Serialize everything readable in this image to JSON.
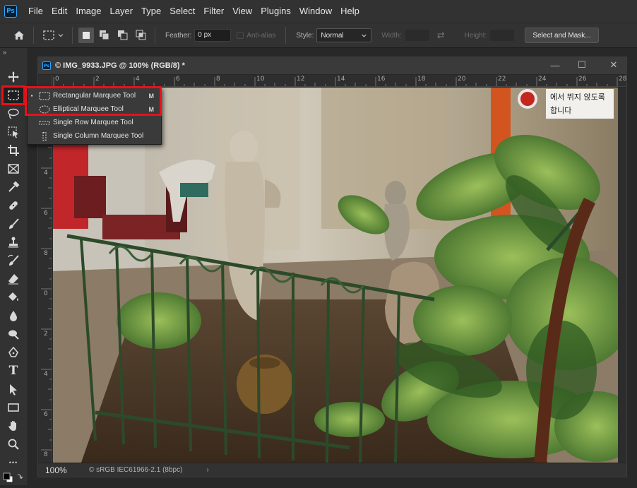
{
  "app": {
    "logo": "Ps"
  },
  "menu": [
    "File",
    "Edit",
    "Image",
    "Layer",
    "Type",
    "Select",
    "Filter",
    "View",
    "Plugins",
    "Window",
    "Help"
  ],
  "options": {
    "feather_label": "Feather:",
    "feather_value": "0 px",
    "antialias_label": "Anti-alias",
    "style_label": "Style:",
    "style_value": "Normal",
    "width_label": "Width:",
    "height_label": "Height:",
    "select_mask_label": "Select and Mask..."
  },
  "document": {
    "title": "© IMG_9933.JPG @ 100% (RGB/8) *",
    "zoom": "100%",
    "profile": "© sRGB IEC61966-2.1 (8bpc)",
    "chevron": "›",
    "ruler_top": [
      "0",
      "2",
      "4",
      "6",
      "8",
      "10",
      "12",
      "14",
      "16",
      "18",
      "20",
      "22",
      "24",
      "26",
      "28"
    ],
    "ruler_left": [
      "0",
      "2",
      "4",
      "6",
      "8",
      "0",
      "2",
      "4",
      "6",
      "8",
      "0"
    ],
    "sign_line1": "에서 뛰지 않도록",
    "sign_line2": "합니다"
  },
  "flyout": {
    "items": [
      {
        "label": "Rectangular Marquee Tool",
        "key": "M",
        "selected": "▪"
      },
      {
        "label": "Elliptical Marquee Tool",
        "key": "M",
        "selected": ""
      },
      {
        "label": "Single Row Marquee Tool",
        "key": "",
        "selected": ""
      },
      {
        "label": "Single Column Marquee Tool",
        "key": "",
        "selected": ""
      }
    ]
  },
  "toolbar": {
    "collapse": "»",
    "tools": [
      "move-icon",
      "rectangular-marquee-icon",
      "lasso-icon",
      "object-selection-icon",
      "crop-icon",
      "frame-icon",
      "eyedropper-icon",
      "spot-healing-icon",
      "brush-icon",
      "clone-stamp-icon",
      "history-brush-icon",
      "eraser-icon",
      "paint-bucket-icon",
      "blur-icon",
      "dodge-icon",
      "pen-icon",
      "type-icon",
      "path-selection-icon",
      "rectangle-icon",
      "hand-icon",
      "zoom-icon",
      "more-icon"
    ],
    "type_glyph": "T",
    "more_glyph": "•••"
  },
  "colors": {
    "highlight": "#e8111a",
    "accent": "#31a8ff"
  }
}
